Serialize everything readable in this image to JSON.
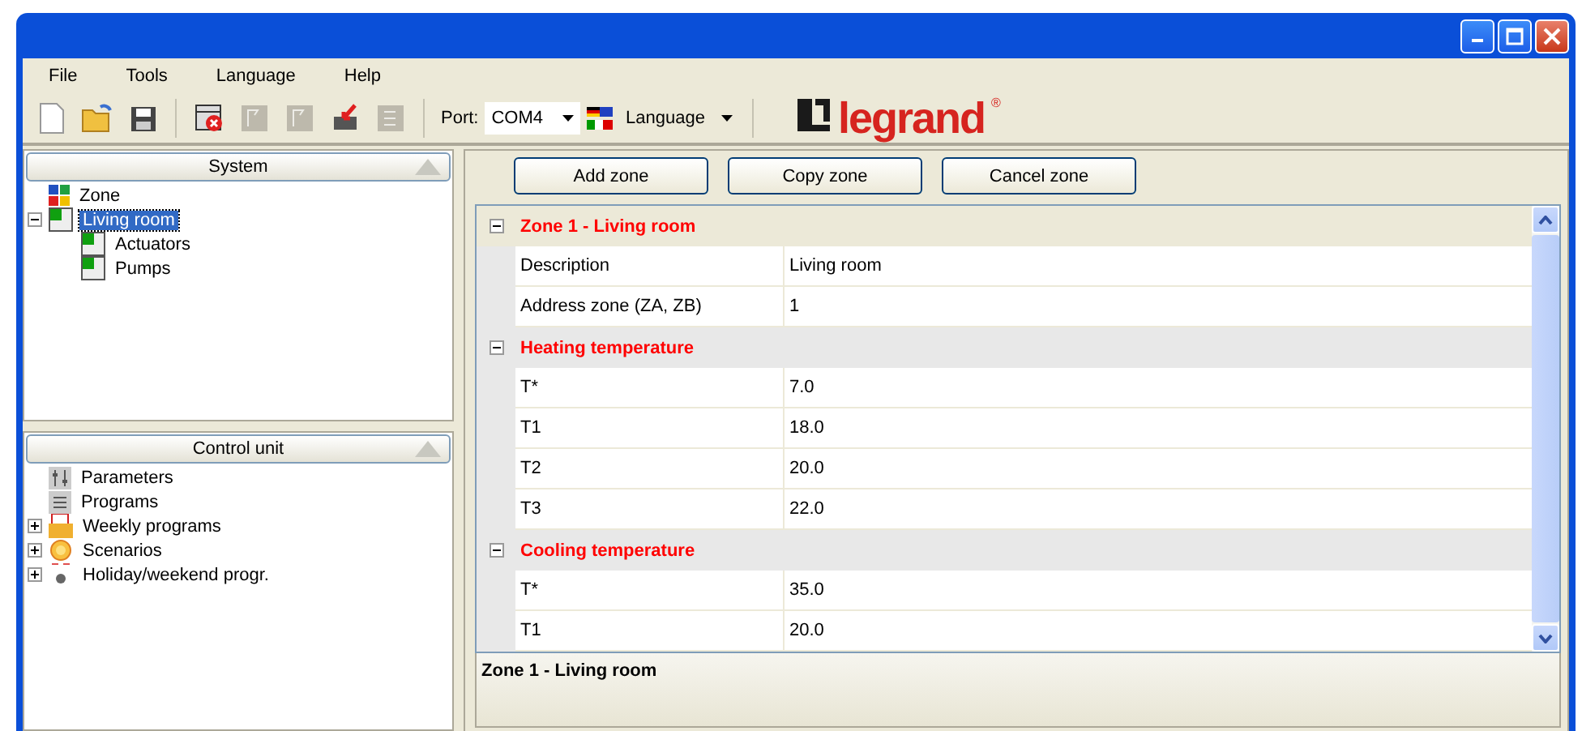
{
  "menu": [
    "File",
    "Tools",
    "Language",
    "Help"
  ],
  "toolbar": [
    {
      "kind": "new",
      "disabled": false
    },
    {
      "kind": "open",
      "disabled": false
    },
    {
      "kind": "save",
      "disabled": false
    },
    {
      "kind": "sep"
    },
    {
      "kind": "erase",
      "disabled": false
    },
    {
      "kind": "flag",
      "disabled": true
    },
    {
      "kind": "flag",
      "disabled": true
    },
    {
      "kind": "download",
      "disabled": false
    },
    {
      "kind": "report",
      "disabled": true
    },
    {
      "kind": "sep"
    }
  ],
  "port": {
    "label": "Port:",
    "value": "COM4"
  },
  "language": {
    "label": "Language"
  },
  "logo": {
    "text": "legrand",
    "mark": "®"
  },
  "system_panel": {
    "title": "System",
    "tree": [
      {
        "label": "Zone",
        "kind": "zone",
        "selected": false
      },
      {
        "label": "Living room",
        "kind": "room",
        "selected": true,
        "expanded": true,
        "children": [
          {
            "label": "Actuators",
            "kind": "room",
            "selected": false
          },
          {
            "label": "Pumps",
            "kind": "room",
            "selected": false
          }
        ]
      }
    ]
  },
  "control_panel": {
    "title": "Control unit",
    "tree": [
      {
        "label": "Parameters",
        "kind": "parameters",
        "selected": false
      },
      {
        "label": "Programs",
        "kind": "programs",
        "selected": false
      },
      {
        "label": "Weekly programs",
        "kind": "weekly",
        "selected": false,
        "expanded": false
      },
      {
        "label": "Scenarios",
        "kind": "scenarios",
        "selected": false,
        "expanded": false
      },
      {
        "label": "Holiday/weekend progr.",
        "kind": "holiday",
        "selected": false,
        "expanded": false
      }
    ]
  },
  "buttons": [
    "Add zone",
    "Copy zone",
    "Cancel zone"
  ],
  "property_grid": {
    "categories": [
      {
        "title": "Zone 1 - Living room",
        "selected": true,
        "expanded": true,
        "rows": [
          {
            "name": "Description",
            "value": "Living room"
          },
          {
            "name": "Address zone (ZA, ZB)",
            "value": "1"
          }
        ]
      },
      {
        "title": "Heating temperature",
        "selected": false,
        "expanded": true,
        "rows": [
          {
            "name": "T*",
            "value": "7.0"
          },
          {
            "name": "T1",
            "value": "18.0"
          },
          {
            "name": "T2",
            "value": "20.0"
          },
          {
            "name": "T3",
            "value": "22.0"
          }
        ]
      },
      {
        "title": "Cooling temperature",
        "selected": false,
        "expanded": true,
        "rows": [
          {
            "name": "T*",
            "value": "35.0"
          },
          {
            "name": "T1",
            "value": "20.0"
          }
        ]
      }
    ]
  },
  "description": {
    "title": "Zone 1 - Living room"
  }
}
